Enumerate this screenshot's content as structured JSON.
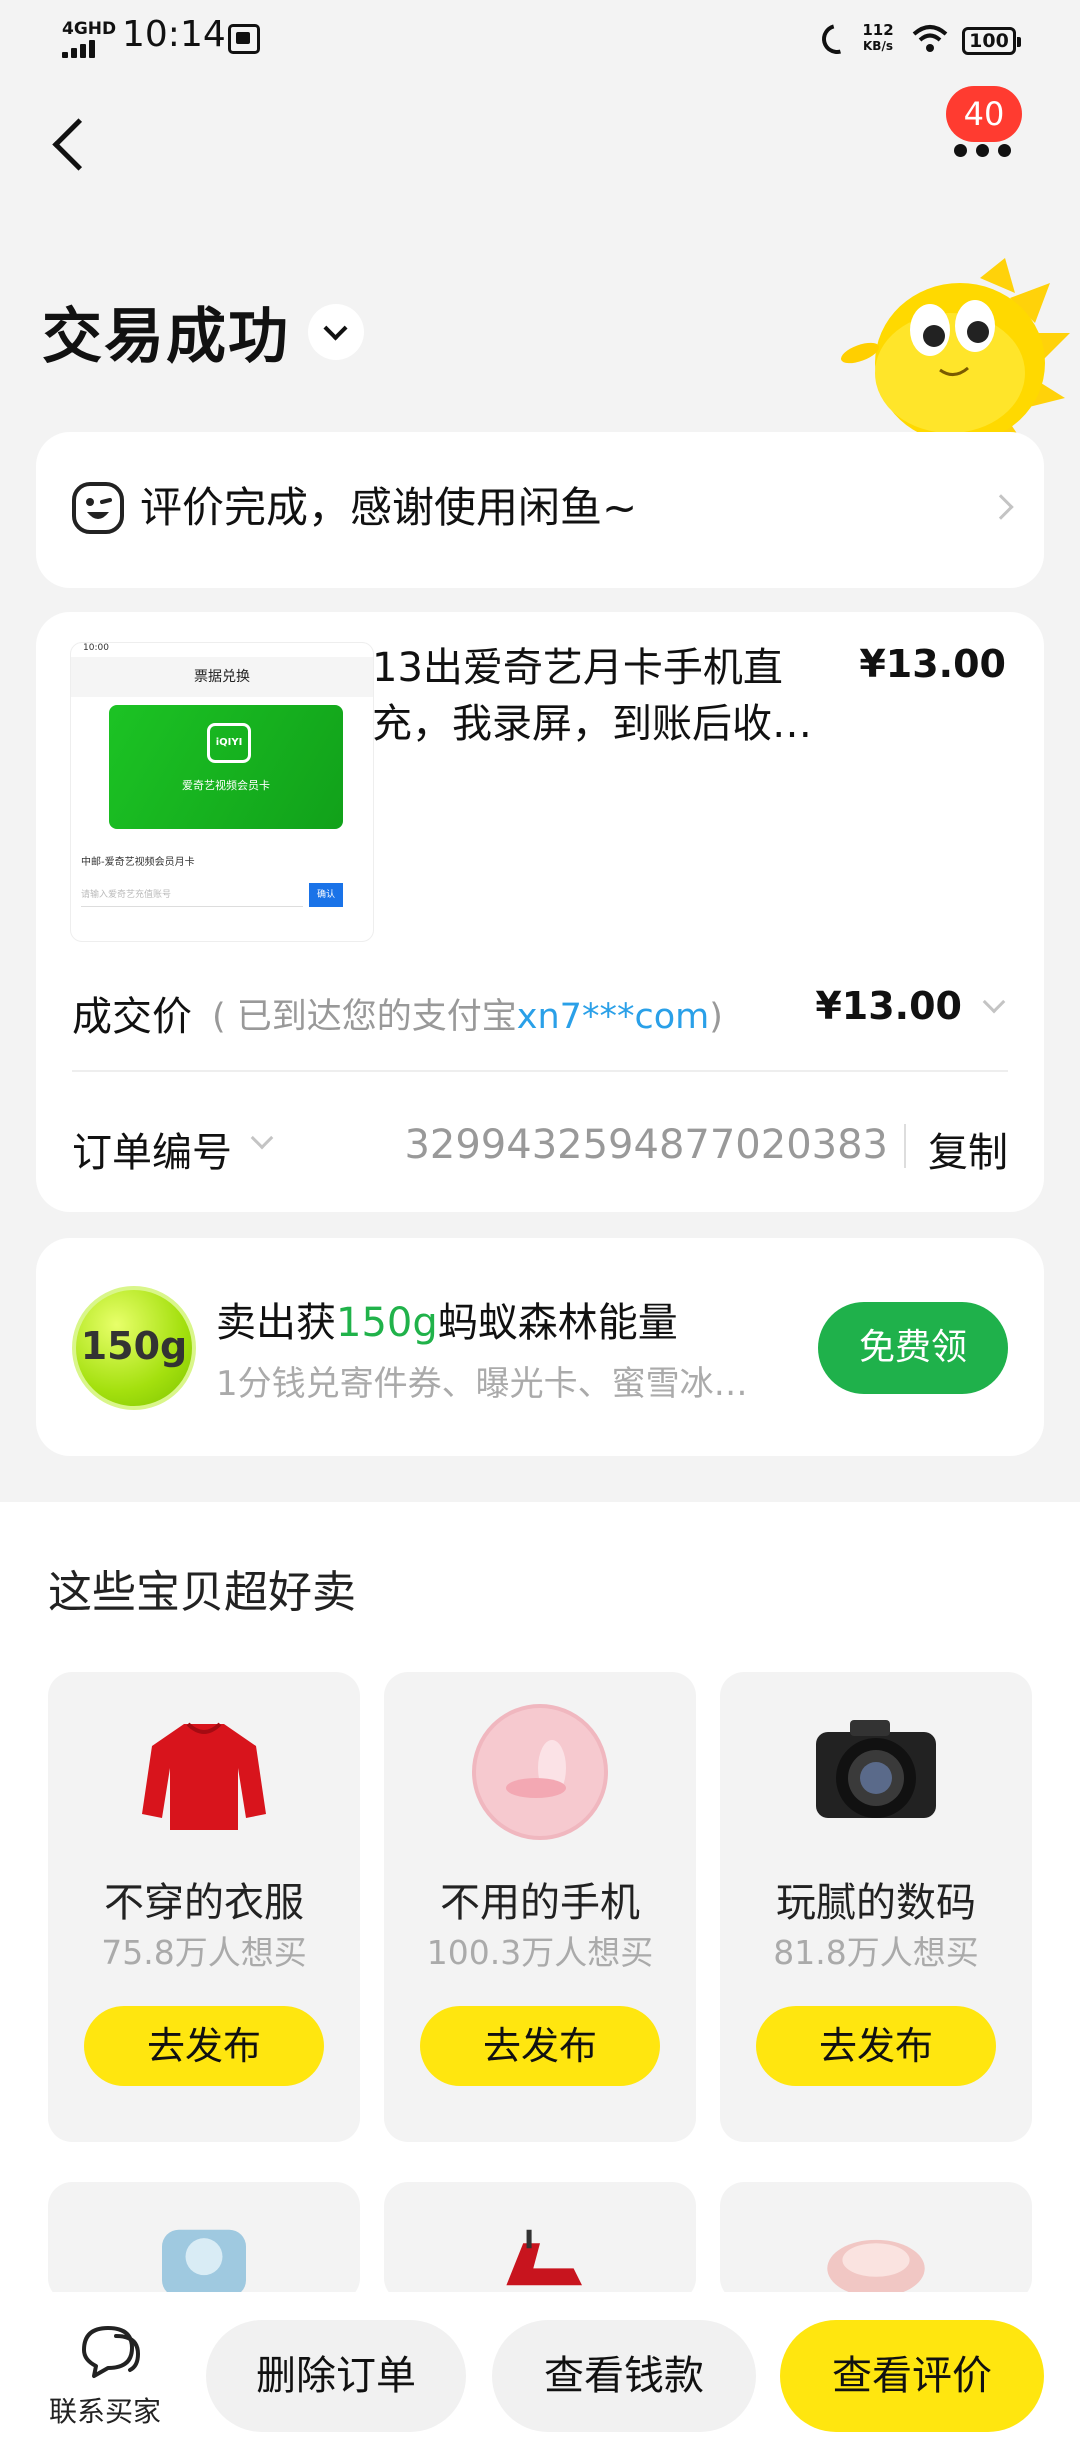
{
  "status_bar": {
    "network": "4GHD",
    "time": "10:14",
    "speed_value": "112",
    "speed_unit": "KB/s",
    "battery": "100"
  },
  "header": {
    "notification_count": "40",
    "title": "交易成功"
  },
  "review_banner": {
    "text": "评价完成，感谢使用闲鱼~"
  },
  "order": {
    "product_title": "13出爱奇艺月卡手机直充，我录屏，到账后收…",
    "product_price": "¥13.00",
    "thumbnail": {
      "time": "10:00",
      "header": "票据兑换",
      "logo_text": "iQIYI",
      "card_caption": "爱奇艺视频会员卡",
      "product_line": "中邮-爱奇艺视频会员月卡",
      "input_placeholder": "请输入爱奇艺充值账号",
      "confirm_label": "确认"
    },
    "deal_label": "成交价",
    "deal_note_prefix": "( 已到达您的支付宝",
    "deal_note_account": "xn7***com",
    "deal_note_suffix": ")",
    "deal_price": "¥13.00",
    "order_no_label": "订单编号",
    "order_no": "3299432594877020383",
    "copy_label": "复制"
  },
  "energy": {
    "badge": "150g",
    "title_prefix": "卖出获",
    "title_highlight": "150g",
    "title_suffix": "蚂蚁森林能量",
    "subtitle": "1分钱兑寄件券、曝光卡、蜜雪冰…",
    "button": "免费领"
  },
  "recommend": {
    "title": "这些宝贝超好卖",
    "tiles": [
      {
        "title": "不穿的衣服",
        "sub": "75.8万人想买",
        "button": "去发布"
      },
      {
        "title": "不用的手机",
        "sub": "100.3万人想买",
        "button": "去发布"
      },
      {
        "title": "玩腻的数码",
        "sub": "81.8万人想买",
        "button": "去发布"
      }
    ]
  },
  "bottom_bar": {
    "contact": "联系买家",
    "delete": "删除订单",
    "view_funds": "查看钱款",
    "view_review": "查看评价"
  },
  "colors": {
    "accent_yellow": "#ffe60f",
    "green": "#1fb14b",
    "badge_red": "#ff3b30",
    "link_blue": "#2aa0e8"
  }
}
